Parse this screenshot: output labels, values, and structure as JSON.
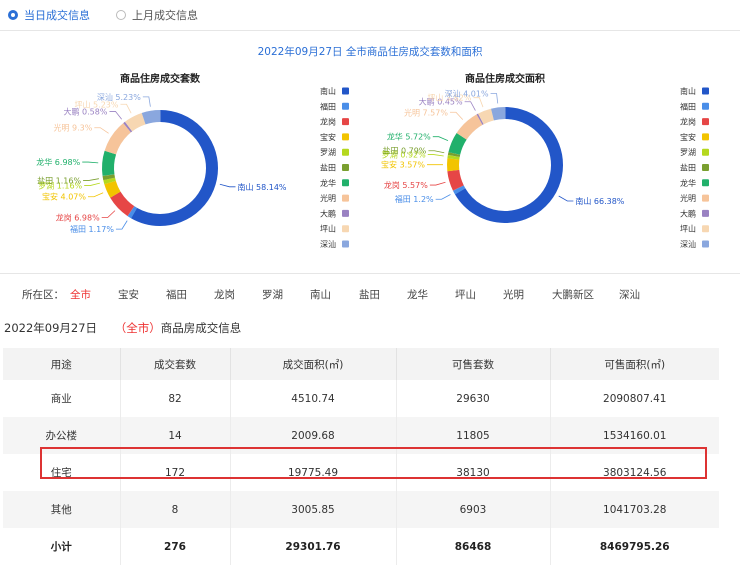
{
  "tabs": [
    {
      "label": "当日成交信息",
      "active": true
    },
    {
      "label": "上月成交信息",
      "active": false
    }
  ],
  "chart_title": "2022年09月27日 全市商品住房成交套数和面积",
  "chart_data": [
    {
      "type": "pie",
      "title": "商品住房成交套数",
      "labels": [
        "南山",
        "福田",
        "龙岗",
        "宝安",
        "罗湖",
        "盐田",
        "龙华",
        "光明",
        "大鹏",
        "坪山",
        "深汕"
      ],
      "values": [
        58.14,
        1.17,
        6.98,
        4.07,
        1.16,
        1.16,
        6.98,
        9.3,
        0.58,
        5.23,
        5.23
      ],
      "unit": "%"
    },
    {
      "type": "pie",
      "title": "商品住房成交面积",
      "labels": [
        "南山",
        "福田",
        "龙岗",
        "宝安",
        "罗湖",
        "盐田",
        "龙华",
        "光明",
        "大鹏",
        "坪山",
        "深汕"
      ],
      "values": [
        66.38,
        1.2,
        5.57,
        3.57,
        0.92,
        0.79,
        5.72,
        7.57,
        0.45,
        3.82,
        4.01
      ],
      "unit": "%"
    }
  ],
  "legend": {
    "items": [
      "南山",
      "福田",
      "龙岗",
      "宝安",
      "罗湖",
      "盐田",
      "龙华",
      "光明",
      "大鹏",
      "坪山",
      "深汕"
    ],
    "colors": [
      "#2256c8",
      "#4a8ee8",
      "#e64646",
      "#f2c400",
      "#b5d81e",
      "#7a9f2f",
      "#21b06b",
      "#f6c49a",
      "#9a82c2",
      "#f7d7b2",
      "#8aa7de"
    ]
  },
  "districts": {
    "label": "所在区：",
    "items": [
      "全市",
      "宝安",
      "福田",
      "龙岗",
      "罗湖",
      "南山",
      "盐田",
      "龙华",
      "坪山",
      "光明",
      "大鹏新区",
      "深汕"
    ],
    "active": "全市"
  },
  "table_title": {
    "date": "2022年09月27日",
    "scope_prefix": "（",
    "scope": "全市",
    "scope_suffix": "）",
    "suffix": "商品房成交信息"
  },
  "table": {
    "headers": [
      "用途",
      "成交套数",
      "成交面积(㎡)",
      "可售套数",
      "可售面积(㎡)"
    ],
    "rows": [
      [
        "商业",
        "82",
        "4510.74",
        "29630",
        "2090807.41"
      ],
      [
        "办公楼",
        "14",
        "2009.68",
        "11805",
        "1534160.01"
      ],
      [
        "住宅",
        "172",
        "19775.49",
        "38130",
        "3803124.56"
      ],
      [
        "其他",
        "8",
        "3005.85",
        "6903",
        "1041703.28"
      ],
      [
        "小计",
        "276",
        "29301.76",
        "86468",
        "8469795.26"
      ]
    ]
  }
}
